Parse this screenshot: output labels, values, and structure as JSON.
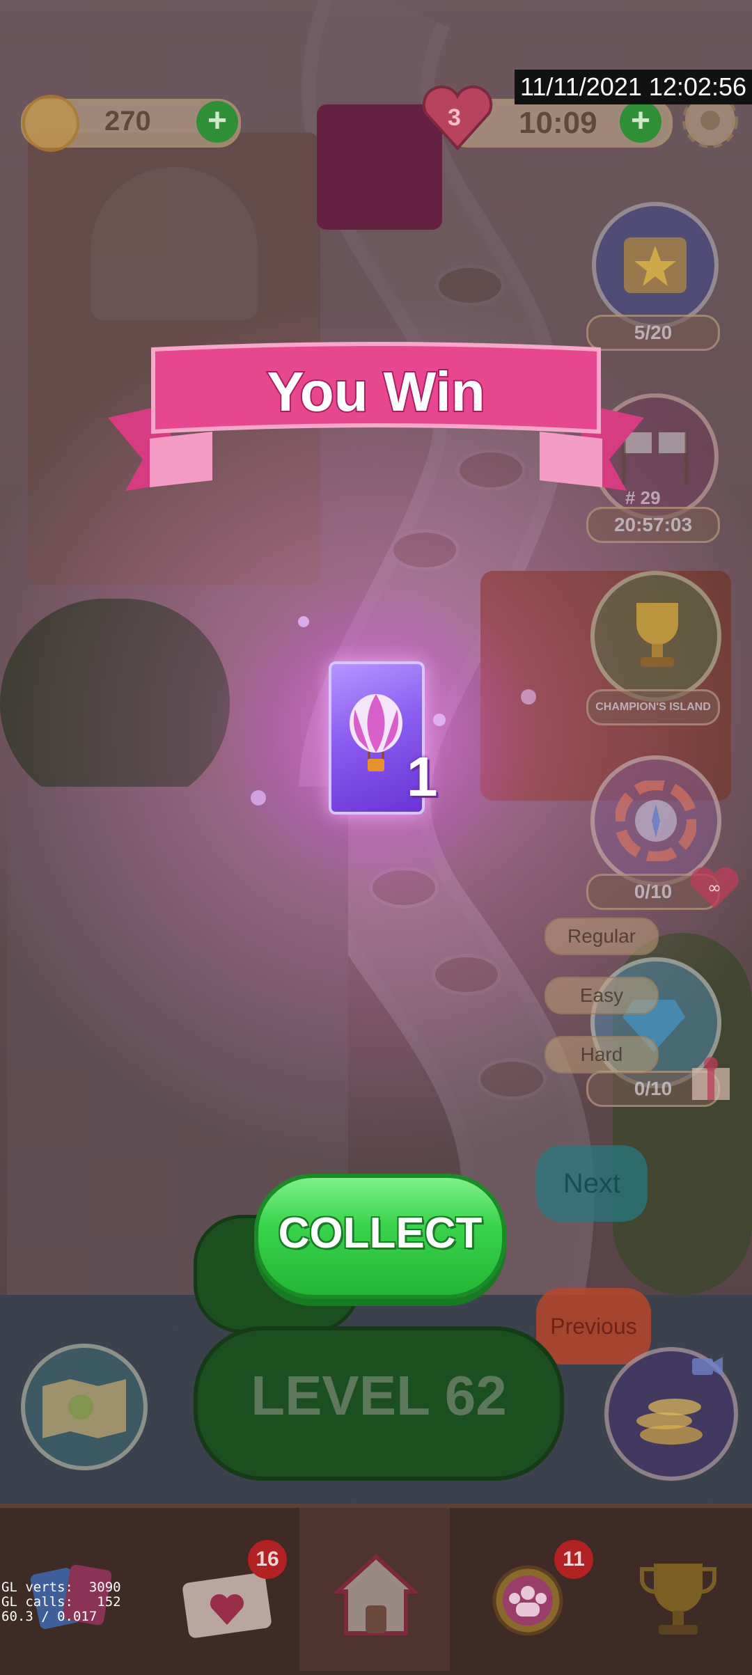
{
  "top_bar": {
    "coins": "270",
    "lives": "3",
    "lives_timer": "10:09",
    "datetime_overlay": "11/11/2021 12:02:56"
  },
  "side_panel": {
    "album_progress": "5/20",
    "race_rank": "# 29",
    "race_timer": "20:57:03",
    "champions_island_label": "CHAMPION'S ISLAND",
    "spin_progress": "0/10",
    "gift_progress": "0/10"
  },
  "debug_buttons": {
    "regular": "Regular",
    "easy": "Easy",
    "hard": "Hard",
    "next": "Next",
    "previous": "Previous"
  },
  "reward": {
    "title": "You Win",
    "item_icon": "hot-air-balloon-icon",
    "count": "1",
    "collect_label": "COLLECT"
  },
  "level_button": {
    "label": "LEVEL 62"
  },
  "bottom_nav": {
    "items": [
      {
        "name": "cards",
        "icon": "cards-icon"
      },
      {
        "name": "mail",
        "icon": "mail-heart-icon",
        "badge": "16"
      },
      {
        "name": "home",
        "icon": "home-icon"
      },
      {
        "name": "friends",
        "icon": "team-icon",
        "badge": "11"
      },
      {
        "name": "trophy",
        "icon": "trophy-icon"
      }
    ]
  },
  "gl_debug": {
    "verts": "GL verts:  3090",
    "calls": "GL calls:   152",
    "fps": "60.3 / 0.017"
  },
  "colors": {
    "banner_pink": "#e6478f",
    "collect_green": "#3ad44c",
    "reward_purple": "#8a5cf0",
    "badge_red": "#b32222"
  }
}
